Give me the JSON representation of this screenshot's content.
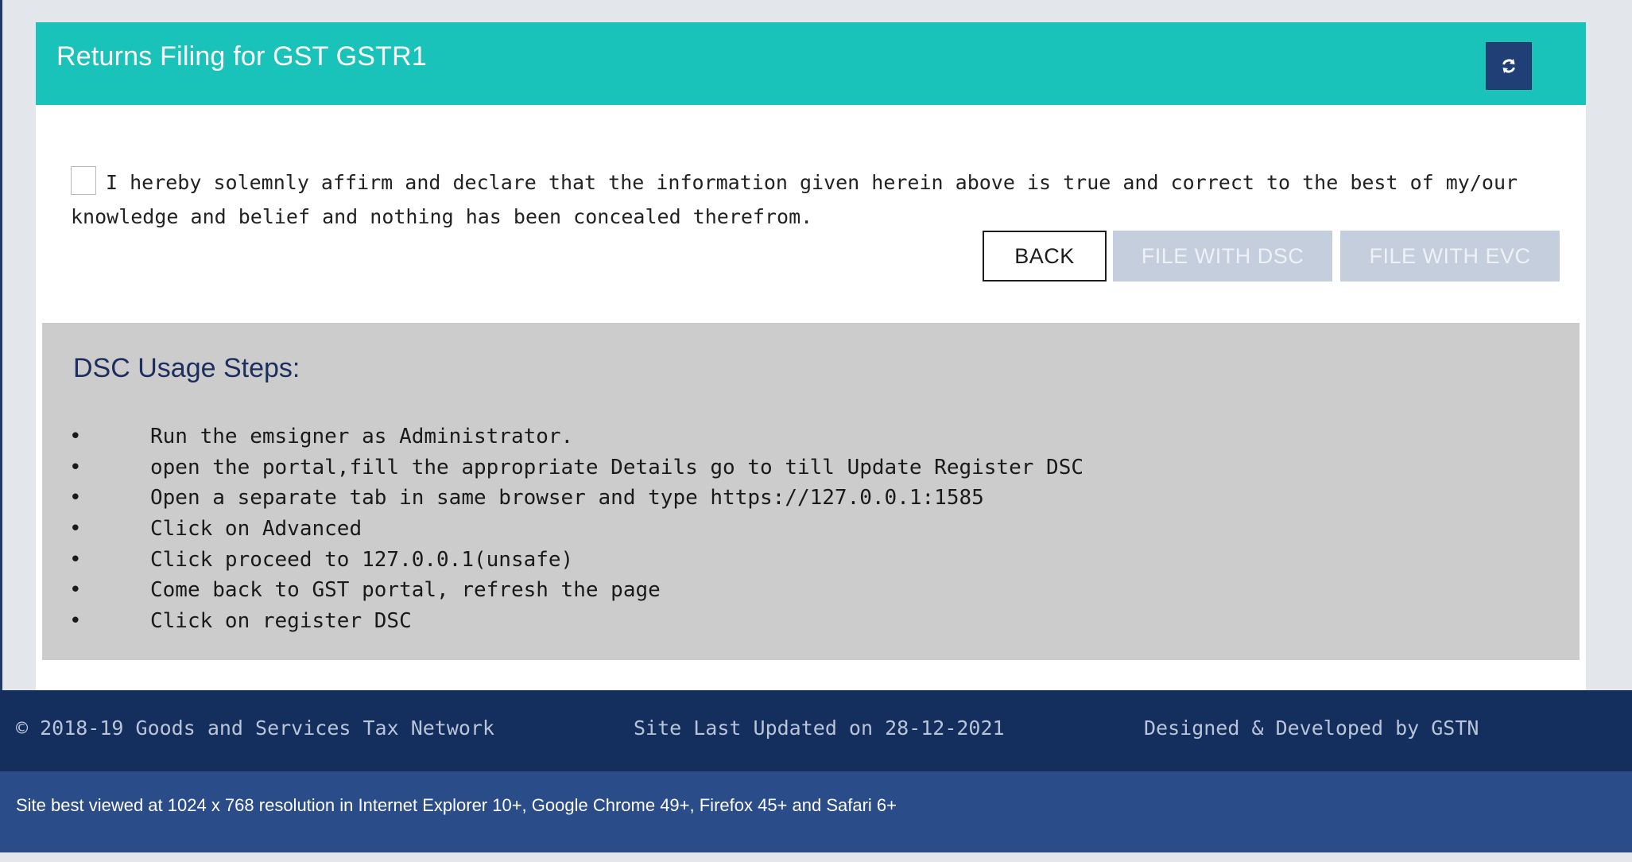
{
  "panel": {
    "title": "Returns Filing for GST GSTR1",
    "refresh_icon": "refresh-icon",
    "declaration_text": "I hereby solemnly affirm and declare that the information given herein above is true and correct to the best of my/our knowledge and belief and nothing has been concealed therefrom.",
    "buttons": {
      "back": "BACK",
      "file_dsc": "FILE WITH DSC",
      "file_evc": "FILE WITH EVC"
    }
  },
  "dsc": {
    "title": "DSC Usage Steps:",
    "bullet": "•",
    "steps": [
      "Run the emsigner as Administrator.",
      "open the portal,fill the appropriate Details go to till Update Register DSC",
      "Open a separate tab in same browser and type https://127.0.0.1:1585",
      "Click on Advanced",
      "Click proceed to 127.0.0.1(unsafe)",
      "Come back to GST portal, refresh the page",
      "Click on register DSC"
    ]
  },
  "footer": {
    "copyright": "© 2018-19 Goods and Services Tax Network",
    "last_updated": "Site Last Updated on 28-12-2021",
    "designed_by": "Designed & Developed by GSTN",
    "best_viewed": "Site best viewed at 1024 x 768 resolution in Internet Explorer 10+, Google Chrome 49+, Firefox 45+ and Safari 6+"
  },
  "colors": {
    "header": "#19c3b9",
    "refresh_button": "#1f3f76",
    "disabled_button": "#c5cedd",
    "dsc_box": "#cccccc",
    "footer_top": "#142f5e",
    "footer_bottom": "#2a4c88"
  }
}
